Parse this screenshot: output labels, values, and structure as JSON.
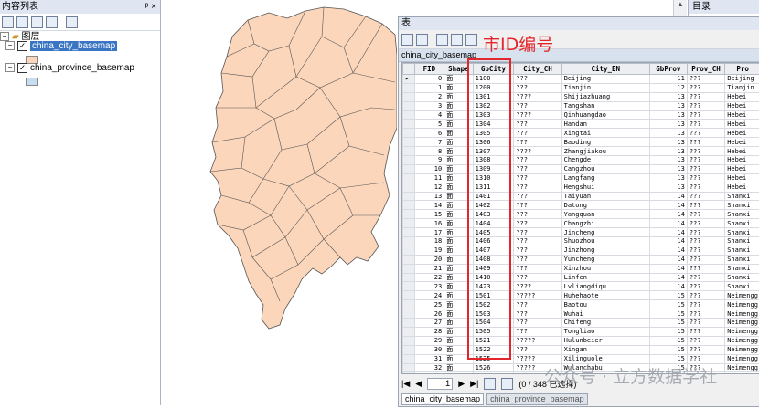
{
  "toc": {
    "title": "内容列表",
    "pin_glyph": "ᵖ ×",
    "root_label": "图层",
    "layers": [
      {
        "name": "china_city_basemap",
        "checked": true,
        "selected": true,
        "swatch": "#fcd6bb"
      },
      {
        "name": "china_province_basemap",
        "checked": true,
        "selected": false,
        "swatch": "#c8dcf2"
      }
    ]
  },
  "right_panel": {
    "title": "目录"
  },
  "table_window": {
    "title": "表",
    "layer_name": "china_city_basemap",
    "columns": [
      "FID",
      "Shape",
      "GbCity",
      "City_CH",
      "City_EN",
      "GbProv",
      "Prov_CH",
      "Pro"
    ],
    "rows": [
      [
        "0",
        "面",
        "1100",
        "???",
        "Beijing",
        "11",
        "???",
        "Beijing"
      ],
      [
        "1",
        "面",
        "1200",
        "???",
        "Tianjin",
        "12",
        "???",
        "Tianjin"
      ],
      [
        "2",
        "面",
        "1301",
        "????",
        "Shijiazhuang",
        "13",
        "???",
        "Hebei"
      ],
      [
        "3",
        "面",
        "1302",
        "???",
        "Tangshan",
        "13",
        "???",
        "Hebei"
      ],
      [
        "4",
        "面",
        "1303",
        "????",
        "Qinhuangdao",
        "13",
        "???",
        "Hebei"
      ],
      [
        "5",
        "面",
        "1304",
        "???",
        "Handan",
        "13",
        "???",
        "Hebei"
      ],
      [
        "6",
        "面",
        "1305",
        "???",
        "Xingtai",
        "13",
        "???",
        "Hebei"
      ],
      [
        "7",
        "面",
        "1306",
        "???",
        "Baoding",
        "13",
        "???",
        "Hebei"
      ],
      [
        "8",
        "面",
        "1307",
        "????",
        "Zhangjiakou",
        "13",
        "???",
        "Hebei"
      ],
      [
        "9",
        "面",
        "1308",
        "???",
        "Chengde",
        "13",
        "???",
        "Hebei"
      ],
      [
        "10",
        "面",
        "1309",
        "???",
        "Cangzhou",
        "13",
        "???",
        "Hebei"
      ],
      [
        "11",
        "面",
        "1310",
        "???",
        "Langfang",
        "13",
        "???",
        "Hebei"
      ],
      [
        "12",
        "面",
        "1311",
        "???",
        "Hengshui",
        "13",
        "???",
        "Hebei"
      ],
      [
        "13",
        "面",
        "1401",
        "???",
        "Taiyuan",
        "14",
        "???",
        "Shanxi"
      ],
      [
        "14",
        "面",
        "1402",
        "???",
        "Datong",
        "14",
        "???",
        "Shanxi"
      ],
      [
        "15",
        "面",
        "1403",
        "???",
        "Yangquan",
        "14",
        "???",
        "Shanxi"
      ],
      [
        "16",
        "面",
        "1404",
        "???",
        "Changzhi",
        "14",
        "???",
        "Shanxi"
      ],
      [
        "17",
        "面",
        "1405",
        "???",
        "Jincheng",
        "14",
        "???",
        "Shanxi"
      ],
      [
        "18",
        "面",
        "1406",
        "???",
        "Shuozhou",
        "14",
        "???",
        "Shanxi"
      ],
      [
        "19",
        "面",
        "1407",
        "???",
        "Jinzhong",
        "14",
        "???",
        "Shanxi"
      ],
      [
        "20",
        "面",
        "1408",
        "???",
        "Yuncheng",
        "14",
        "???",
        "Shanxi"
      ],
      [
        "21",
        "面",
        "1409",
        "???",
        "Xinzhou",
        "14",
        "???",
        "Shanxi"
      ],
      [
        "22",
        "面",
        "1410",
        "???",
        "Linfen",
        "14",
        "???",
        "Shanxi"
      ],
      [
        "23",
        "面",
        "1423",
        "????",
        "Lvliangdiqu",
        "14",
        "???",
        "Shanxi"
      ],
      [
        "24",
        "面",
        "1501",
        "?????",
        "Huhehaote",
        "15",
        "???",
        "Neimengg"
      ],
      [
        "25",
        "面",
        "1502",
        "???",
        "Baotou",
        "15",
        "???",
        "Neimengg"
      ],
      [
        "26",
        "面",
        "1503",
        "???",
        "Wuhai",
        "15",
        "???",
        "Neimengg"
      ],
      [
        "27",
        "面",
        "1504",
        "???",
        "Chifeng",
        "15",
        "???",
        "Neimengg"
      ],
      [
        "28",
        "面",
        "1505",
        "???",
        "Tongliao",
        "15",
        "???",
        "Neimengg"
      ],
      [
        "29",
        "面",
        "1521",
        "?????",
        "Hulunbeier",
        "15",
        "???",
        "Neimengg"
      ],
      [
        "30",
        "面",
        "1522",
        "???",
        "Xingan",
        "15",
        "???",
        "Neimengg"
      ],
      [
        "31",
        "面",
        "1525",
        "?????",
        "Xilinguole",
        "15",
        "???",
        "Neimengg"
      ],
      [
        "32",
        "面",
        "1526",
        "?????",
        "Wulanchabu",
        "15",
        "???",
        "Neimengg"
      ],
      [
        "33",
        "面",
        "1527",
        "???",
        "Yikezhao",
        "15",
        "???",
        "Neimengg"
      ]
    ],
    "nav": {
      "first": "|◀",
      "prev": "◀",
      "page": "1",
      "next": "▶",
      "last": "▶|",
      "status": "(0 / 348 已选择)"
    },
    "tabs": [
      "china_city_basemap",
      "china_province_basemap"
    ]
  },
  "annotation": {
    "label": "市ID编号",
    "color": "#e3262b"
  },
  "watermark": "公众号 · 立方数据学社",
  "colors": {
    "map_fill": "#fcd6bb",
    "map_stroke": "#555555",
    "selection": "#3a75c4"
  }
}
